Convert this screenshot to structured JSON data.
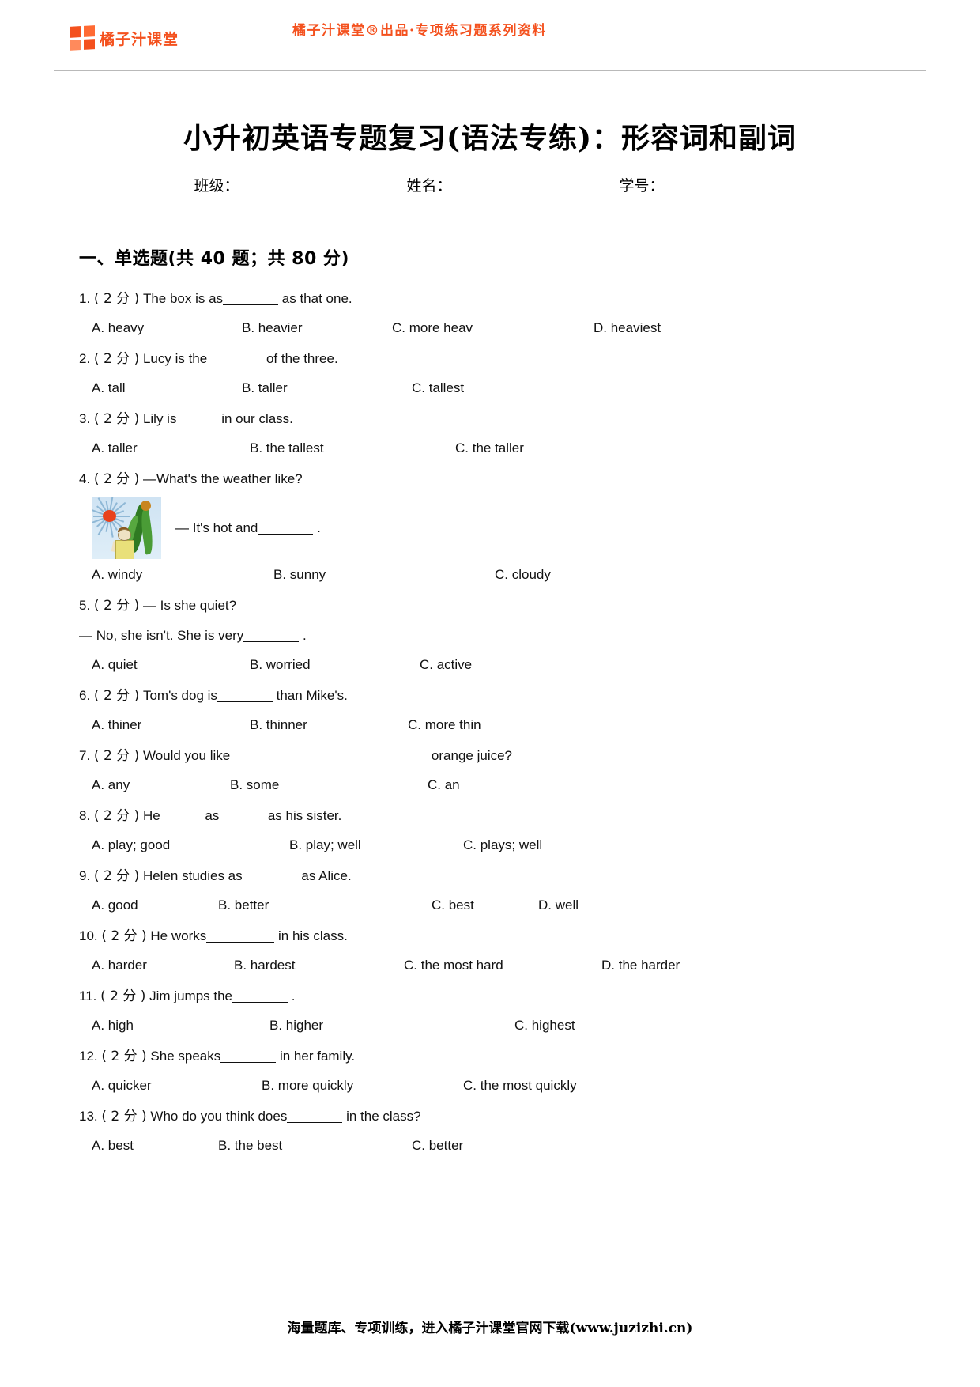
{
  "header": {
    "logo_text": "橘子汁课堂",
    "logo_icon": "four-squares-logo-icon",
    "slogan": "橘子汁课堂®出品·专项练习题系列资料",
    "brand_color": "#f4511e"
  },
  "title": "小升初英语专题复习(语法专练)：形容词和副词",
  "student_fields": [
    {
      "label": "班级："
    },
    {
      "label": "姓名："
    },
    {
      "label": "学号："
    }
  ],
  "section": {
    "heading": "一、单选题(共 40 题；共 80 分)"
  },
  "questions": [
    {
      "num": "1.",
      "points": "( 2 分 )",
      "stem_before": "The box is as",
      "blank": "md",
      "stem_after": "as that one.",
      "options": [
        "A. heavy",
        "B. heavier",
        "C. more heav",
        "D. heaviest"
      ],
      "widths": [
        "190px",
        "190px",
        "255px",
        "160px"
      ]
    },
    {
      "num": "2.",
      "points": "( 2 分 )",
      "stem_before": "Lucy is the",
      "blank": "md",
      "stem_after": "of the three.",
      "options": [
        "A. tall",
        "B. taller",
        "C. tallest"
      ],
      "widths": [
        "190px",
        "215px",
        "230px"
      ]
    },
    {
      "num": "3.",
      "points": "( 2 分 )",
      "stem_before": "Lily is",
      "blank": "sm",
      "stem_after": "in our class.",
      "options": [
        "A. taller",
        "B. the tallest",
        "C. the taller"
      ],
      "widths": [
        "200px",
        "260px",
        "230px"
      ]
    },
    {
      "num": "4.",
      "points": "( 2 分  )",
      "stem_before": "—What's  the  weather  like?",
      "blank": "none",
      "stem_after": "",
      "has_image": true,
      "image_name": "sunny-weather-illustration",
      "answer_before": "— It's hot and",
      "answer_blank": "md",
      "answer_after": ".",
      "options": [
        "A. windy",
        "B. sunny",
        "C. cloudy"
      ],
      "widths": [
        "230px",
        "280px",
        "230px"
      ]
    },
    {
      "num": "5.",
      "points": "( 2 分 )",
      "stem_before": "— Is she quiet?",
      "blank": "none",
      "stem_after": "",
      "second_line_before": "— No, she isn't. She is very",
      "second_line_blank": "md",
      "second_line_after": ".",
      "options": [
        "A. quiet",
        "B. worried",
        "C. active"
      ],
      "widths": [
        "200px",
        "215px",
        "230px"
      ]
    },
    {
      "num": "6.",
      "points": "( 2 分 )",
      "stem_before": "Tom's dog is",
      "blank": "md",
      "stem_after": "than Mike's.",
      "options": [
        "A. thiner",
        "B. thinner",
        "C. more thin"
      ],
      "widths": [
        "200px",
        "200px",
        "230px"
      ]
    },
    {
      "num": "7.",
      "points": "( 2 分 )",
      "stem_before": "Would you like",
      "blank": "xl",
      "stem_after": "orange juice?",
      "options": [
        "A. any",
        "B. some",
        "C. an"
      ],
      "widths": [
        "175px",
        "250px",
        "230px"
      ]
    },
    {
      "num": "8.",
      "points": "( 2 分 )",
      "stem_before": "He",
      "blank": "sm",
      "stem_mid": "as",
      "blank2": "sm",
      "stem_after": "as his sister.",
      "options": [
        "A. play; good",
        "B. play; well",
        "C. plays; well"
      ],
      "widths": [
        "250px",
        "220px",
        "230px"
      ]
    },
    {
      "num": "9.",
      "points": "( 2 分 )",
      "stem_before": "Helen studies as",
      "blank": "md",
      "stem_after": "as Alice.",
      "options": [
        "A. good",
        "B. better",
        "C. best",
        "D. well"
      ],
      "widths": [
        "160px",
        "270px",
        "135px",
        "140px"
      ]
    },
    {
      "num": "10.",
      "points": "( 2 分 )",
      "stem_before": "He works",
      "blank": "lg",
      "stem_after": "in his class.",
      "options": [
        "A. harder",
        "B. hardest",
        "C. the most hard",
        "D. the harder"
      ],
      "widths": [
        "180px",
        "215px",
        "250px",
        "160px"
      ]
    },
    {
      "num": "11.",
      "points": "( 2 分 )",
      "stem_before": "Jim jumps the",
      "blank": "md",
      "stem_after": ".",
      "options": [
        "A. high",
        "B. higher",
        "C. highest"
      ],
      "widths": [
        "225px",
        "310px",
        "160px"
      ]
    },
    {
      "num": "12.",
      "points": "( 2 分 )",
      "stem_before": "She speaks",
      "blank": "md",
      "stem_after": "in her family.",
      "options": [
        "A. quicker",
        "B. more quickly",
        "C. the most quickly"
      ],
      "widths": [
        "215px",
        "255px",
        "230px"
      ]
    },
    {
      "num": "13.",
      "points": "( 2 分 )",
      "stem_before": "Who do you think does",
      "blank": "md",
      "stem_after": "in the class?",
      "options": [
        "A. best",
        "B. the best",
        "C. better"
      ],
      "widths": [
        "160px",
        "245px",
        "230px"
      ]
    }
  ],
  "footer": {
    "text": "海量题库、专项训练，进入橘子汁课堂官网下载(www.juzizhi.cn)"
  }
}
